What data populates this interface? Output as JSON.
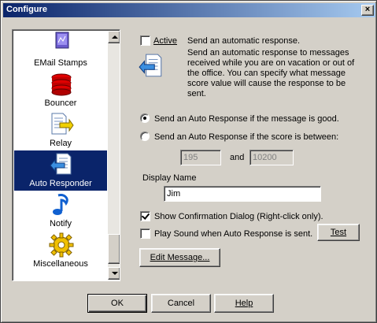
{
  "window": {
    "title": "Configure",
    "close_glyph": "×"
  },
  "sidebar": {
    "items": [
      {
        "label": "EMail Stamps",
        "icon": "stamp-icon",
        "selected": false
      },
      {
        "label": "Bouncer",
        "icon": "bouncer-stack-icon",
        "selected": false
      },
      {
        "label": "Relay",
        "icon": "relay-icon",
        "selected": false
      },
      {
        "label": "Auto Responder",
        "icon": "auto-responder-icon",
        "selected": true
      },
      {
        "label": "Notify",
        "icon": "music-note-icon",
        "selected": false
      },
      {
        "label": "Miscellaneous",
        "icon": "gear-icon",
        "selected": false
      }
    ]
  },
  "active": {
    "checked": false,
    "label": "Active",
    "summary": "Send an automatic response.",
    "description": "Send an automatic response to messages received while you are on vacation or out of the office.  You can specify what message score value will cause the response to be sent."
  },
  "mode": {
    "good_label": "Send an Auto Response if the message is good.",
    "range_label": "Send an Auto Response if the score is between:",
    "selected": "good",
    "min_value": "195",
    "and_label": "and",
    "max_value": "10200"
  },
  "display_name": {
    "label": "Display Name",
    "value": "Jim"
  },
  "options": {
    "confirm_label": "Show Confirmation Dialog (Right-click only).",
    "confirm_checked": true,
    "sound_label": "Play Sound when Auto Response is sent.",
    "sound_checked": false,
    "test_label": "Test"
  },
  "edit_message_label": "Edit Message...",
  "footer": {
    "ok_label": "OK",
    "cancel_label": "Cancel",
    "help_label": "Help"
  }
}
